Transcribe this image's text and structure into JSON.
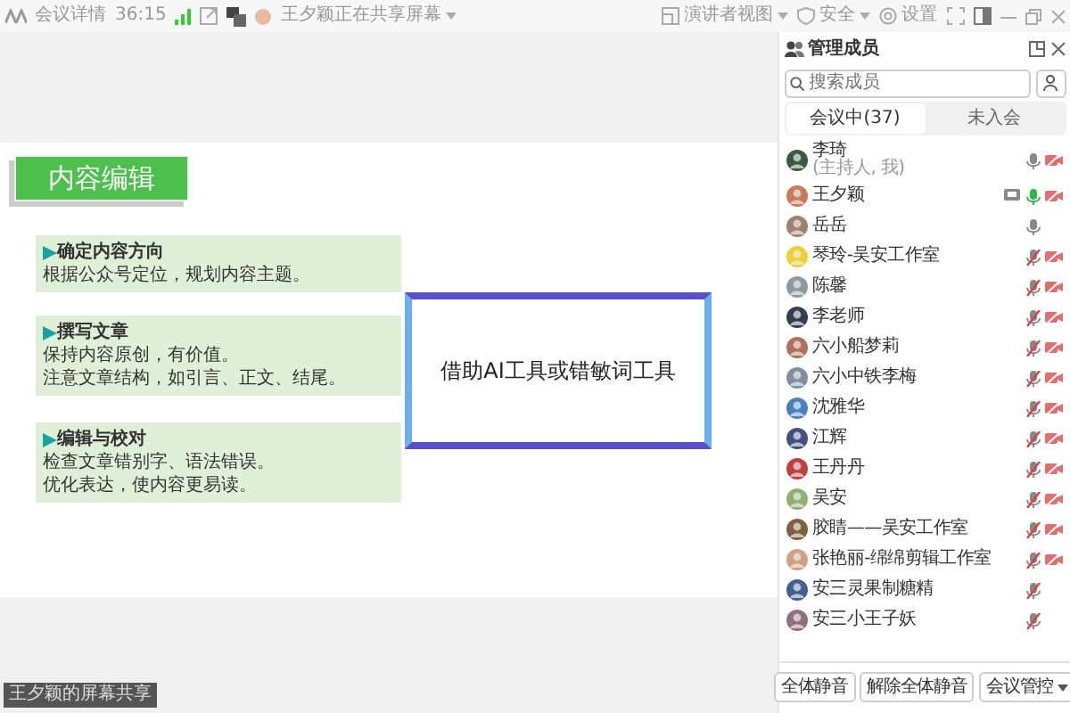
{
  "topbar": {
    "meeting_details": "会议详情",
    "timer": "36:15",
    "sharing_notice": "王夕颖正在共享屏幕",
    "right_items": [
      {
        "kind": "view",
        "label": "演讲者视图"
      },
      {
        "kind": "security",
        "label": "安全"
      },
      {
        "kind": "settings",
        "label": "设置"
      }
    ]
  },
  "slide": {
    "title": "内容编辑",
    "sections": [
      {
        "heading": "确定内容方向",
        "lines": [
          "根据公众号定位，规划内容主题。"
        ]
      },
      {
        "heading": "撰写文章",
        "lines": [
          "保持内容原创，有价值。",
          "注意文章结构，如引言、正文、结尾。"
        ]
      },
      {
        "heading": "编辑与校对",
        "lines": [
          "检查文章错别字、语法错误。",
          "优化表达，使内容更易读。"
        ]
      }
    ],
    "callout": "借助AI工具或错敏词工具"
  },
  "share_label": "王夕颖的屏幕共享",
  "panel": {
    "title": "管理成员",
    "search": {
      "placeholder": "搜索成员"
    },
    "tabs": [
      {
        "label": "会议中(37)",
        "selected": true
      },
      {
        "label": "未入会",
        "selected": false
      }
    ],
    "members": [
      {
        "name": "李琦",
        "note": "(主持人, 我)",
        "sharing": false,
        "muted": false,
        "speaking": false,
        "camera_off": true
      },
      {
        "name": "王夕颖",
        "sharing": true,
        "muted": false,
        "speaking": true,
        "camera_off": true
      },
      {
        "name": "岳岳",
        "sharing": false,
        "muted": false,
        "speaking": false,
        "camera_off": false
      },
      {
        "name": "琴玲-吴安工作室",
        "sharing": false,
        "muted": true,
        "speaking": false,
        "camera_off": true
      },
      {
        "name": "陈馨",
        "sharing": false,
        "muted": true,
        "speaking": false,
        "camera_off": true
      },
      {
        "name": "李老师",
        "sharing": false,
        "muted": true,
        "speaking": false,
        "camera_off": true
      },
      {
        "name": "六小船梦莉",
        "sharing": false,
        "muted": true,
        "speaking": false,
        "camera_off": true
      },
      {
        "name": "六小中铁李梅",
        "sharing": false,
        "muted": true,
        "speaking": false,
        "camera_off": true
      },
      {
        "name": "沈雅华",
        "sharing": false,
        "muted": true,
        "speaking": false,
        "camera_off": true
      },
      {
        "name": "江辉",
        "sharing": false,
        "muted": true,
        "speaking": false,
        "camera_off": true
      },
      {
        "name": "王丹丹",
        "sharing": false,
        "muted": true,
        "speaking": false,
        "camera_off": true
      },
      {
        "name": "吴安",
        "sharing": false,
        "muted": true,
        "speaking": false,
        "camera_off": true
      },
      {
        "name": "胶睛——吴安工作室",
        "sharing": false,
        "muted": true,
        "speaking": false,
        "camera_off": true
      },
      {
        "name": "张艳丽-绵绵剪辑工作室",
        "sharing": false,
        "muted": true,
        "speaking": false,
        "camera_off": true
      },
      {
        "name": "安三灵果制糖精",
        "sharing": false,
        "muted": true,
        "speaking": false,
        "camera_off": false
      },
      {
        "name": "安三小王子妖",
        "sharing": false,
        "muted": true,
        "speaking": false,
        "camera_off": false
      }
    ],
    "buttons": [
      {
        "label": "全体静音",
        "dropdown": false
      },
      {
        "label": "解除全体静音",
        "dropdown": false
      },
      {
        "label": "会议管控",
        "dropdown": true
      }
    ]
  }
}
